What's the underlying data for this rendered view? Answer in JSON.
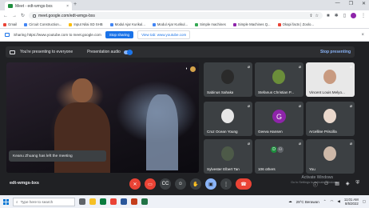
{
  "browser": {
    "tab_title": "Meet - edt-wmgs-bxs",
    "tab_close": "×",
    "new_tab": "+",
    "window_controls": [
      "—",
      "❐",
      "✕"
    ],
    "url": "meet.google.com/edt-wmgs-bxs",
    "bookmarks": [
      {
        "label": "Gmail",
        "color": "#ea4335"
      },
      {
        "label": "Circuit Construction...",
        "color": "#4285f4"
      },
      {
        "label": "Input Nilai SD SHB",
        "color": "#fbbc04"
      },
      {
        "label": "Modul Ajar Kurikul...",
        "color": "#4285f4"
      },
      {
        "label": "Modul Ajar Kurikul...",
        "color": "#4285f4"
      },
      {
        "label": "Simple machines",
        "color": "#34a853"
      },
      {
        "label": "Simple Machines Q...",
        "color": "#8e24aa"
      },
      {
        "label": "Okapi facts | Zoolo...",
        "color": "#ea4335"
      }
    ]
  },
  "share_notice": {
    "message": "Sharing https://www.youtube.com to meet.google.com",
    "stop_label": "Stop sharing",
    "view_label": "View tab: www.youtube.com",
    "close": "×"
  },
  "presenting_bar": {
    "status": "You're presenting to everyone",
    "audio_label": "Presentation audio",
    "stop_label": "Stop presenting"
  },
  "main": {
    "toast": "Keanu Zhuang has left the meeting"
  },
  "participants": [
    {
      "name": "Sabinus Sahaka",
      "face_color": "#2a2a2a",
      "tile_bg": "#3c4043"
    },
    {
      "name": "Stefanus Christian P...",
      "face_color": "#6b8e3a",
      "tile_bg": "#3c4043"
    },
    {
      "name": "Vincent Louis Melyo...",
      "face_color": "#c89a80",
      "tile_bg": "#e8e8e8"
    },
    {
      "name": "Cruz Ocean Young",
      "face_color": "#e6e6e6",
      "tile_bg": "#3c4043"
    },
    {
      "name": "Geeva Hansen",
      "letter": "G",
      "tile_bg": "#3c4043"
    },
    {
      "name": "Arcelline Priscilla",
      "face_color": "#ead8cc",
      "tile_bg": "#3c4043"
    },
    {
      "name": "Sylvester Elbert Tan",
      "face_color": "#4d5a48",
      "tile_bg": "#3c4043"
    },
    {
      "name": "106 others",
      "others": [
        "D",
        "⚇"
      ],
      "tile_bg": "#3c4043"
    },
    {
      "name": "You",
      "face_color": "#cdb8a8",
      "tile_bg": "#3c4043"
    }
  ],
  "callbar": {
    "meeting_code": "edt-wmgs-bxs",
    "activate_title": "Activate Windows",
    "activate_sub": "Go to Settings to activate Windows."
  },
  "taskbar": {
    "search_placeholder": "Type here to search",
    "weather": "29°C Berawan",
    "time": "11:01 AM",
    "date": "8/5/2022"
  }
}
